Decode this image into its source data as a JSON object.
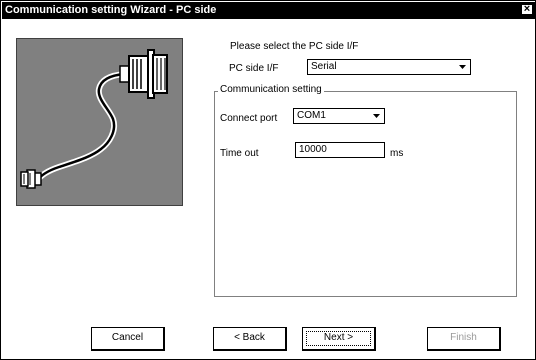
{
  "window": {
    "title": "Communication setting Wizard - PC side",
    "close_glyph": "×"
  },
  "prompt": "Please select the PC side I/F",
  "pc_side_if": {
    "label": "PC side I/F",
    "value": "Serial"
  },
  "group": {
    "title": "Communication setting",
    "connect_port": {
      "label": "Connect port",
      "value": "COM1"
    },
    "time_out": {
      "label": "Time out",
      "value": "10000",
      "unit": "ms"
    }
  },
  "buttons": {
    "cancel": "Cancel",
    "back": "< Back",
    "next": "Next >",
    "finish": "Finish"
  },
  "icons": {
    "illustration": "serial-cable-icon",
    "dropdown": "chevron-down-icon"
  },
  "colors": {
    "title_bg": "#000000",
    "illustration_bg": "#808080",
    "disabled_text": "#9a9a9a"
  }
}
